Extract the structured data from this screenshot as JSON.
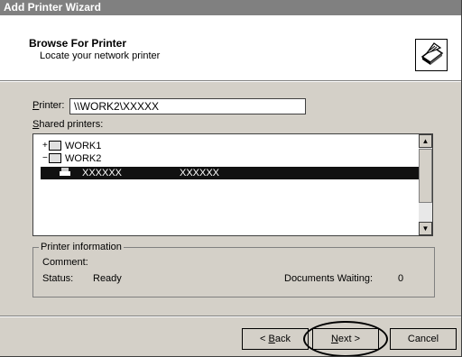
{
  "window": {
    "title": "Add Printer Wizard"
  },
  "header": {
    "title": "Browse For Printer",
    "subtitle": "Locate your network printer",
    "icon": "printer-icon"
  },
  "printer_field": {
    "label_mnemonic": "P",
    "label_rest": "rinter:",
    "value": "\\\\WORK2\\XXXXX"
  },
  "shared_printers": {
    "label_mnemonic": "S",
    "label_rest": "hared printers:",
    "items": [
      {
        "name": "WORK1",
        "icon": "computer-icon",
        "expanded": false
      },
      {
        "name": "WORK2",
        "icon": "computer-icon",
        "expanded": true
      },
      {
        "name": "XXXXXX",
        "comment": "XXXXXX",
        "icon": "printer-icon",
        "selected": true
      }
    ]
  },
  "printer_info": {
    "title": "Printer information",
    "comment_label": "Comment:",
    "comment_value": "",
    "status_label": "Status:",
    "status_value": "Ready",
    "docs_waiting_label": "Documents Waiting:",
    "docs_waiting_value": "0"
  },
  "buttons": {
    "back": {
      "prefix": "< ",
      "mnemonic": "B",
      "rest": "ack"
    },
    "next": {
      "mnemonic": "N",
      "rest": "ext >"
    },
    "cancel": "Cancel"
  }
}
